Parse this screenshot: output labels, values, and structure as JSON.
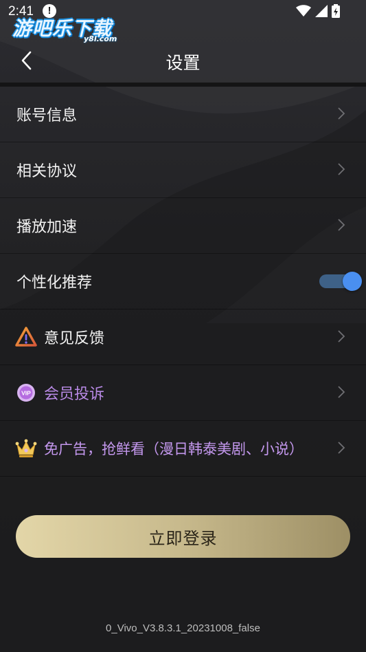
{
  "status_bar": {
    "time": "2:41",
    "notification_icon": "info-icon",
    "icons": [
      "wifi-icon",
      "signal-icon",
      "battery-icon"
    ]
  },
  "watermark": {
    "main": "游吧乐下载",
    "sub": "y8l.com"
  },
  "header": {
    "back_icon": "back-chevron-icon",
    "title": "设置"
  },
  "settings": {
    "account_info": "账号信息",
    "agreements": "相关协议",
    "playback_speed": "播放加速",
    "personalized_recommend": "个性化推荐",
    "personalized_recommend_on": true,
    "feedback": "意见反馈",
    "member_complaint": "会员投诉",
    "no_ads": "免广告，抢鲜看（漫日韩泰美剧、小说）"
  },
  "login_button": "立即登录",
  "version": "0_Vivo_V3.8.3.1_20231008_false",
  "colors": {
    "background": "#232325",
    "toggle_knob": "#4a8ff0",
    "toggle_track": "#3e6187",
    "vip_text": "#b98ae6",
    "login_gradient_start": "#e3d6a8",
    "login_gradient_end": "#9d8f65"
  }
}
